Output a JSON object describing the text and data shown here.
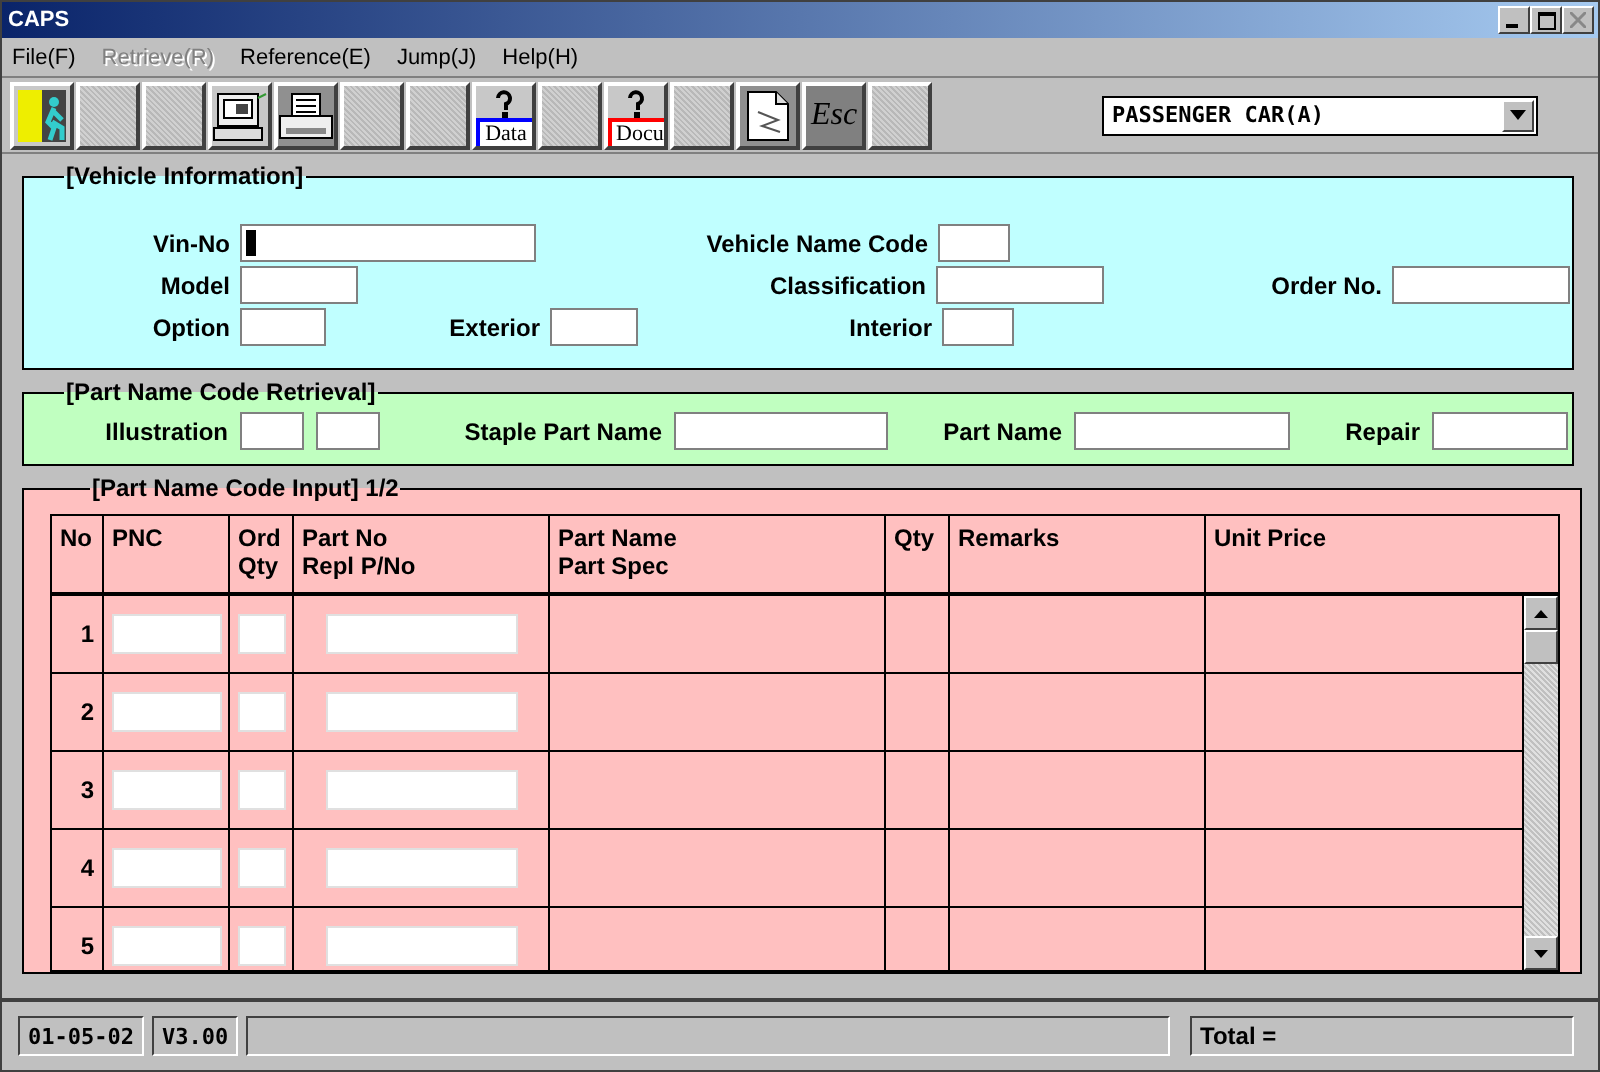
{
  "window": {
    "title": "CAPS"
  },
  "menu": [
    {
      "label": "File(F)",
      "disabled": false
    },
    {
      "label": "Retrieve(R)",
      "disabled": true
    },
    {
      "label": "Reference(E)",
      "disabled": false
    },
    {
      "label": "Jump(J)",
      "disabled": false
    },
    {
      "label": "Help(H)",
      "disabled": false
    }
  ],
  "toolbar": [
    {
      "kind": "exit"
    },
    {
      "kind": "blank"
    },
    {
      "kind": "blank"
    },
    {
      "kind": "computer"
    },
    {
      "kind": "printer"
    },
    {
      "kind": "blank"
    },
    {
      "kind": "blank"
    },
    {
      "kind": "help",
      "label": "Data",
      "color": "#0000ff"
    },
    {
      "kind": "blank"
    },
    {
      "kind": "help",
      "label": "Docu",
      "color": "#ff0000"
    },
    {
      "kind": "blank"
    },
    {
      "kind": "document"
    },
    {
      "kind": "esc",
      "label": "Esc"
    },
    {
      "kind": "blank"
    }
  ],
  "vehicle_type": {
    "value": "PASSENGER CAR(A)"
  },
  "vehicle_information": {
    "title": "[Vehicle Information]",
    "rows": [
      [
        {
          "label": "Vin-No",
          "focused": true
        },
        "",
        {
          "label": "Vehicle Name Code",
          "focused": false
        }
      ],
      [
        {
          "label": "Model",
          "focused": false
        },
        "",
        {
          "label": "Classification",
          "focused": false
        },
        {
          "label": "Order No.",
          "focused": false
        }
      ],
      [
        {
          "label": "Option",
          "focused": false
        },
        {
          "label": "Exterior",
          "focused": false
        },
        {
          "label": "Interior",
          "focused": false
        }
      ]
    ]
  },
  "part_name_code_retrieval": {
    "title": "[Part Name Code Retrieval]",
    "fields": [
      {
        "label": "Illustration"
      },
      {
        "label": "Staple Part Name"
      },
      {
        "label": "Part Name"
      },
      {
        "label": "Repair"
      }
    ]
  },
  "part_name_code_input": {
    "title": "[Part Name Code Input] 1/2",
    "columns": [
      "No",
      "PNC",
      "Ord\nQty",
      "Part No\nRepl P/No",
      "Part Name\nPart Spec",
      "Qty",
      "Remarks",
      "Unit Price"
    ],
    "rows": [
      {
        "no": "1"
      },
      {
        "no": "2"
      },
      {
        "no": "3"
      },
      {
        "no": "4"
      },
      {
        "no": "5"
      }
    ]
  },
  "status_bar": {
    "date": "01-05-02",
    "version": "V3.00",
    "total": "Total ="
  }
}
